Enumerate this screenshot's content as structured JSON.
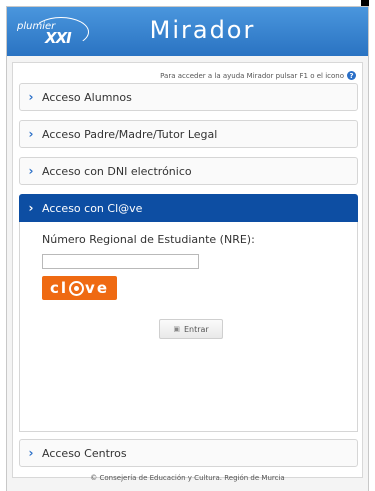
{
  "header": {
    "logo_text": "plumier XXI",
    "title": "Mirador"
  },
  "help": {
    "text": "Para acceder a la ayuda Mirador pulsar F1 o el icono",
    "icon": "?"
  },
  "accordion": {
    "items": [
      {
        "label": "Acceso Alumnos"
      },
      {
        "label": "Acceso Padre/Madre/Tutor Legal"
      },
      {
        "label": "Acceso con DNI electrónico"
      },
      {
        "label": "Acceso con Cl@ve"
      },
      {
        "label": "Acceso Centros"
      }
    ],
    "chevron": "›"
  },
  "clave_panel": {
    "nre_label": "Número Regional de Estudiante (NRE):",
    "nre_value": "",
    "clave_button": {
      "left": "cl",
      "right": "ve"
    },
    "submit_label": "Entrar"
  },
  "footer": {
    "text": "© Consejería de Educación y Cultura. Región de Murcia"
  },
  "colors": {
    "header_blue": "#2a73c2",
    "active_blue": "#0d4ea3",
    "clave_orange": "#ef6a12"
  }
}
